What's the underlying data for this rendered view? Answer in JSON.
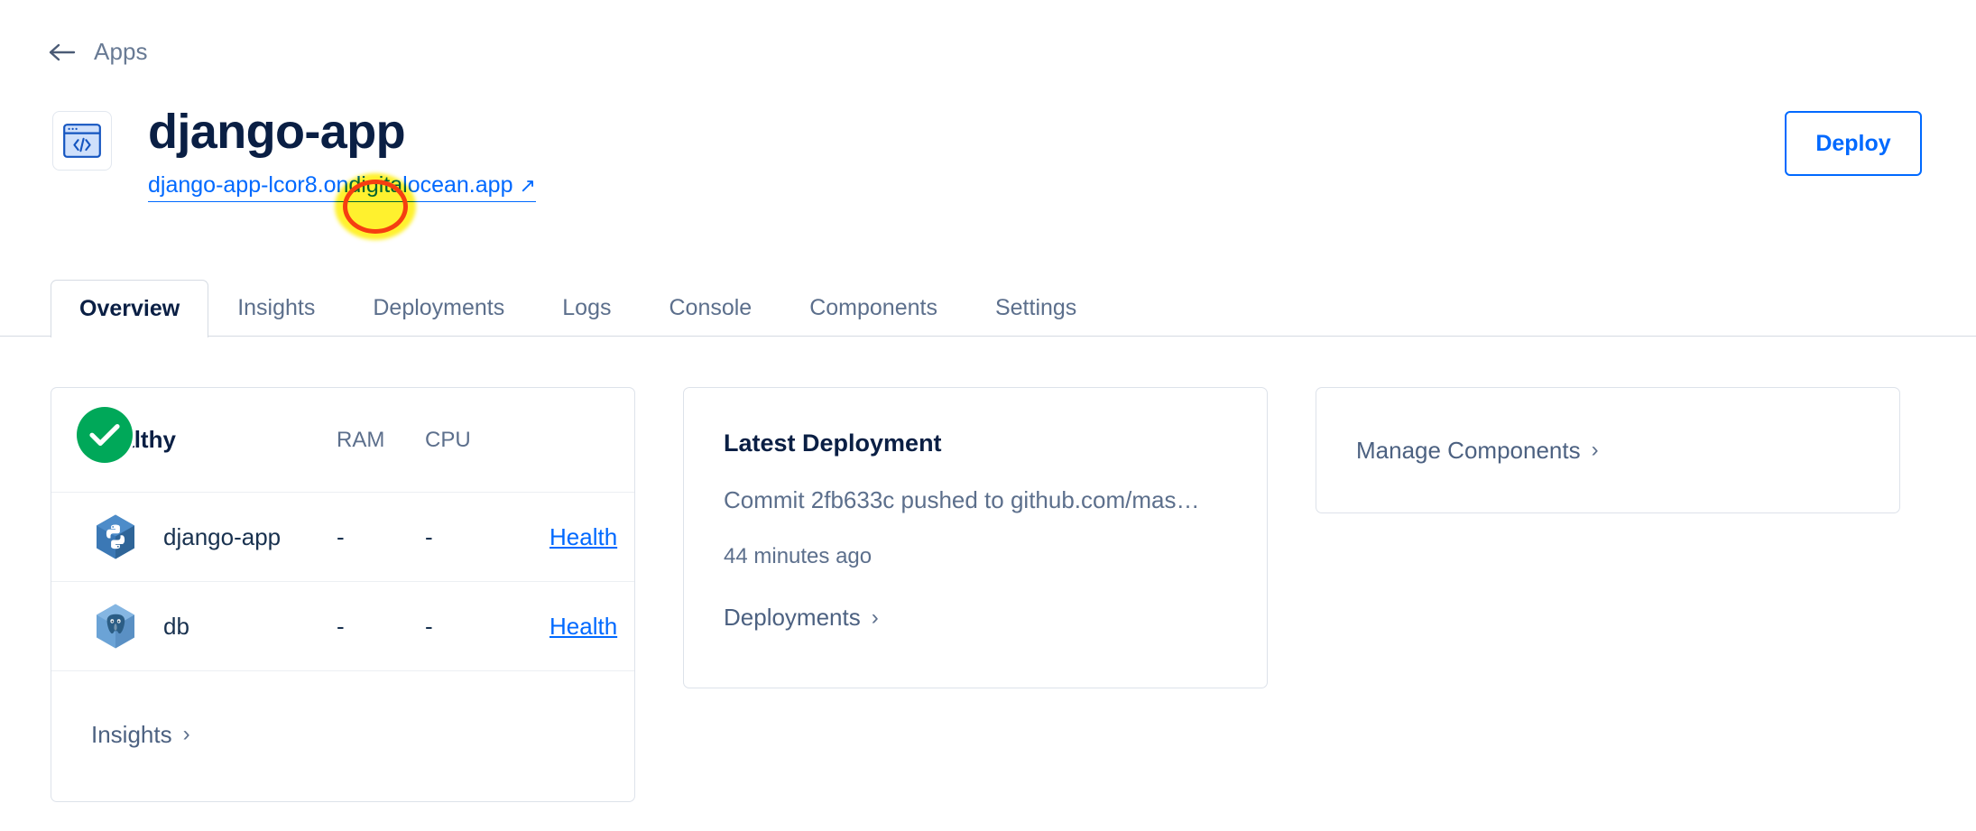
{
  "breadcrumb": {
    "back_icon": "arrow-left-icon",
    "label": "Apps"
  },
  "header": {
    "app_icon": "code-window-icon",
    "title": "django-app",
    "url_text": "django-app-lcor8.ondigitalocean.app",
    "external_link_icon": "↗",
    "deploy_label": "Deploy"
  },
  "annotation": {
    "type": "highlight-circle",
    "highlight_color": "#ffee00",
    "ring_color": "#f53e11",
    "target_text": "ondigi"
  },
  "tabs": [
    {
      "label": "Overview",
      "active": true
    },
    {
      "label": "Insights",
      "active": false
    },
    {
      "label": "Deployments",
      "active": false
    },
    {
      "label": "Logs",
      "active": false
    },
    {
      "label": "Console",
      "active": false
    },
    {
      "label": "Components",
      "active": false
    },
    {
      "label": "Settings",
      "active": false
    }
  ],
  "health_card": {
    "status_icon": "check-circle-icon",
    "status_color": "#00a859",
    "status_label": "Healthy",
    "columns": [
      "RAM",
      "CPU"
    ],
    "rows": [
      {
        "icon": "python-hex-icon",
        "name": "django-app",
        "ram": "-",
        "cpu": "-",
        "link": "Health"
      },
      {
        "icon": "postgresql-hex-icon",
        "name": "db",
        "ram": "-",
        "cpu": "-",
        "link": "Health"
      }
    ],
    "footer_link": "Insights",
    "footer_chevron": "›"
  },
  "deployment_card": {
    "title": "Latest Deployment",
    "commit": "Commit 2fb633c pushed to github.com/mas…",
    "time": "44 minutes ago",
    "link": "Deployments",
    "chevron": "›"
  },
  "components_card": {
    "link": "Manage Components",
    "chevron": "›"
  },
  "colors": {
    "accent": "#0069ff",
    "title": "#0a1f44",
    "muted": "#5c6f8c",
    "healthy": "#00a859",
    "border": "#dde2ea"
  }
}
